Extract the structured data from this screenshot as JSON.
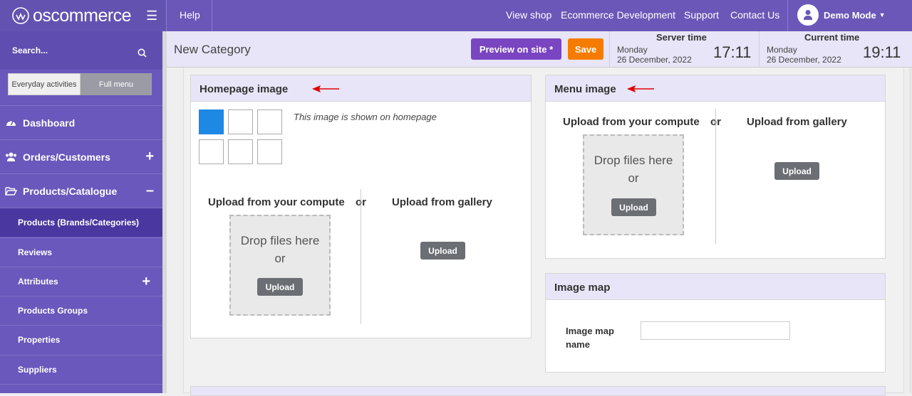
{
  "brand": {
    "logo_text": "oscommerce"
  },
  "topnav": {
    "help": "Help",
    "view_shop": "View shop",
    "ecommerce_dev": "Ecommerce Development",
    "support": "Support",
    "contact": "Contact Us",
    "user": "Demo Mode"
  },
  "sidebar": {
    "search_label": "Search...",
    "toggle_everyday": "Everyday activities",
    "toggle_full": "Full menu",
    "items": [
      {
        "label": "Dashboard"
      },
      {
        "label": "Orders/Customers"
      },
      {
        "label": "Products/Catalogue"
      },
      {
        "label": "Products (Brands/Categories)"
      },
      {
        "label": "Reviews"
      },
      {
        "label": "Attributes"
      },
      {
        "label": "Products Groups"
      },
      {
        "label": "Properties"
      },
      {
        "label": "Suppliers"
      }
    ]
  },
  "header": {
    "title": "New Category",
    "preview_label": "Preview on site *",
    "save_label": "Save",
    "server_time": {
      "label": "Server time",
      "day": "Monday",
      "date": "26 December, 2022",
      "time": "17:11"
    },
    "current_time": {
      "label": "Current time",
      "day": "Monday",
      "date": "26 December, 2022",
      "time": "19:11"
    }
  },
  "homepage_image": {
    "title": "Homepage image",
    "hint": "This image is shown on homepage",
    "upload_computer": "Upload from your computer",
    "or": "or",
    "upload_gallery": "Upload from gallery",
    "drop_line1": "Drop files here",
    "drop_line2": "or",
    "upload_btn": "Upload",
    "gallery_btn": "Upload"
  },
  "menu_image": {
    "title": "Menu image",
    "upload_computer": "Upload from your computer",
    "or": "or",
    "upload_gallery": "Upload from gallery",
    "drop_line1": "Drop files here",
    "drop_line2": "or",
    "upload_btn": "Upload",
    "gallery_btn": "Upload"
  },
  "image_map": {
    "title": "Image map",
    "name_label_line1": "Image map",
    "name_label_line2": "name",
    "name_value": ""
  },
  "colors": {
    "topbar": "#6b57b8",
    "sidebar": "#6a58bc",
    "active": "#4a38a0",
    "preview": "#7a45c0",
    "save": "#f57c00",
    "accent_blue": "#1e88e5",
    "arrow": "#e00000"
  }
}
